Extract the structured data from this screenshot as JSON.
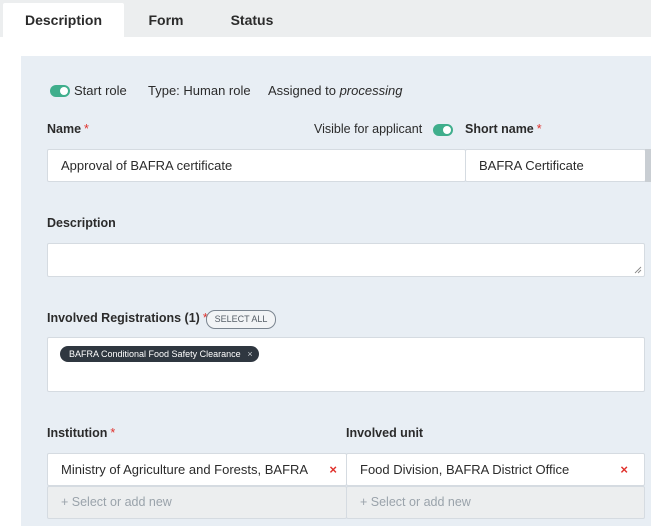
{
  "tabs": [
    {
      "label": "Description",
      "active": true
    },
    {
      "label": "Form",
      "active": false
    },
    {
      "label": "Status",
      "active": false
    }
  ],
  "role_bar": {
    "start_role_label": "Start role",
    "start_role_on": true,
    "type_text": "Type: Human role",
    "assigned_prefix": "Assigned to",
    "assigned_value": "processing"
  },
  "name_field": {
    "label": "Name",
    "value": "Approval of BAFRA certificate"
  },
  "visible_for_applicant": {
    "label": "Visible for applicant",
    "on": true
  },
  "short_name_field": {
    "label": "Short name",
    "value": "BAFRA Certificate"
  },
  "description_field": {
    "label": "Description",
    "value": ""
  },
  "involved_registrations": {
    "label": "Involved Registrations (1)",
    "select_all_label": "SELECT ALL",
    "tags": [
      "BAFRA Conditional Food Safety Clearance"
    ],
    "tag_remove_glyph": "×"
  },
  "institution": {
    "label": "Institution",
    "value": "Ministry of Agriculture and Forests, BAFRA",
    "add_placeholder": "+ Select or add new",
    "remove_glyph": "×"
  },
  "involved_unit": {
    "label": "Involved unit",
    "value": "Food Division, BAFRA District Office",
    "add_placeholder": "+ Select or add new",
    "remove_glyph": "×"
  },
  "required_marker": "*",
  "colors": {
    "accent_toggle": "#3fae8c",
    "required": "#e0302b",
    "panel_bg": "#e8eef4",
    "tag_bg": "#2f3740"
  }
}
